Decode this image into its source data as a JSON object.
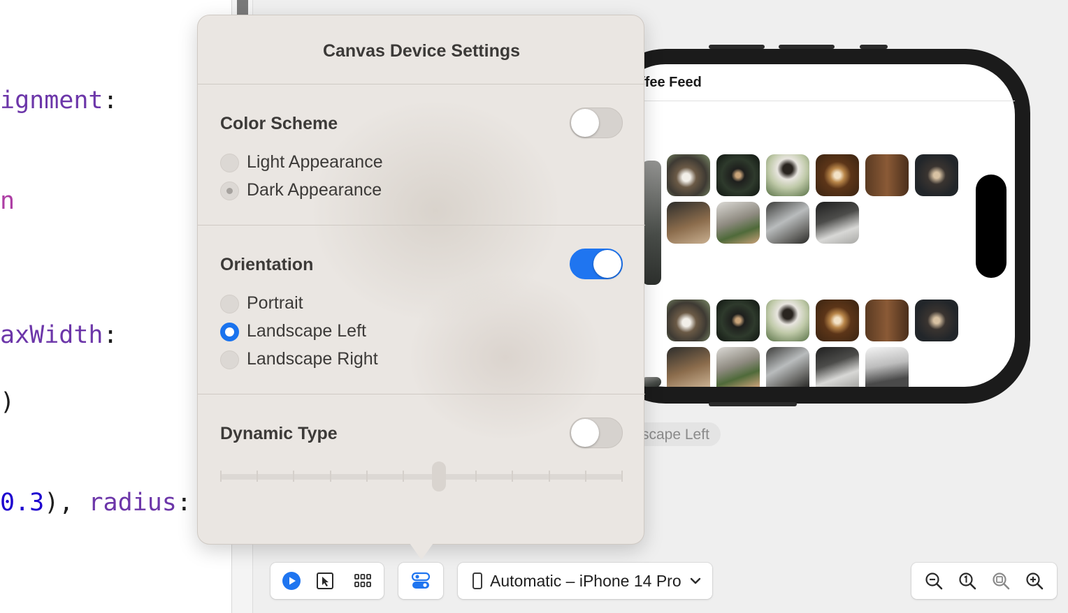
{
  "editor": {
    "lines": [
      {
        "kw": "ignment",
        "rest": ":"
      },
      {
        "kw2": "n"
      },
      {
        "kw": "axWidth",
        "rest": ":"
      },
      {
        "plain": ")"
      },
      {
        "num": "0.3",
        "mid": "), ",
        "kw": "radius",
        "rest": ":"
      }
    ]
  },
  "popover": {
    "title": "Canvas Device Settings",
    "color_scheme": {
      "title": "Color Scheme",
      "enabled": false,
      "options": [
        "Light Appearance",
        "Dark Appearance"
      ],
      "selected": "Dark Appearance"
    },
    "orientation": {
      "title": "Orientation",
      "enabled": true,
      "options": [
        "Portrait",
        "Landscape Left",
        "Landscape Right"
      ],
      "selected": "Landscape Left"
    },
    "dynamic_type": {
      "title": "Dynamic Type",
      "enabled": false,
      "steps": 12,
      "value_step": 7
    }
  },
  "preview": {
    "nav_title": "ffee Feed",
    "mode_label": "scape Left"
  },
  "toolbar": {
    "device_selector": "Automatic – iPhone 14 Pro",
    "icons": [
      "live-preview-icon",
      "selectable-mode-icon",
      "variants-grid-icon",
      "device-settings-icon",
      "device-icon",
      "chevron-down-icon",
      "zoom-out-icon",
      "zoom-actual-size-icon",
      "zoom-to-fit-icon",
      "zoom-in-icon"
    ]
  },
  "colors": {
    "accent": "#1f75f0",
    "popover_bg": "#eae6e2",
    "keyword": "#6c36a9",
    "number": "#1c00cf"
  }
}
